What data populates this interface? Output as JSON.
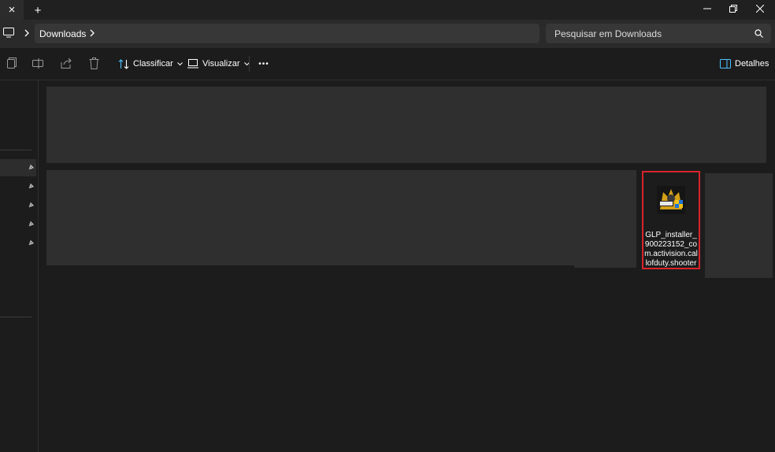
{
  "window": {
    "tab_close_label": "×",
    "new_tab_label": "+"
  },
  "address_bar": {
    "breadcrumb": [
      "Downloads"
    ],
    "search_placeholder": "Pesquisar em Downloads"
  },
  "command_bar": {
    "sort_label": "Classificar",
    "view_label": "Visualizar",
    "more_label": "•••",
    "details_label": "Detalhes"
  },
  "file": {
    "name": "GLP_installer_900223152_com.activision.callofduty.shooter"
  },
  "colors": {
    "selection_border": "#d8242c",
    "accent": "#4cc2ff"
  }
}
